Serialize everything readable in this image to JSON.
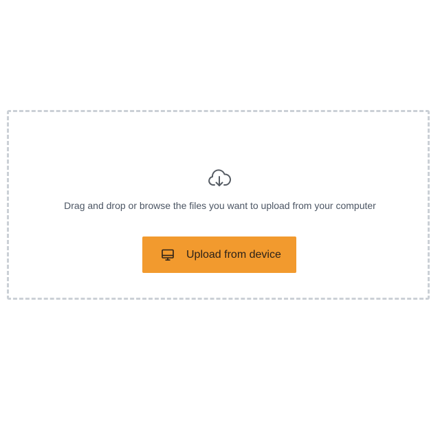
{
  "dropzone": {
    "icon": "cloud-download-icon",
    "instructions": "Drag and drop or browse the files you want to upload from your computer",
    "upload_button": {
      "label": "Upload from device",
      "icon": "desktop-monitor-icon"
    }
  },
  "colors": {
    "button_background": "#f29a2e",
    "button_text": "#2b2118",
    "dashed_border": "#cbd0d6",
    "icon": "#555b63",
    "instruction_text": "#4b5563"
  }
}
